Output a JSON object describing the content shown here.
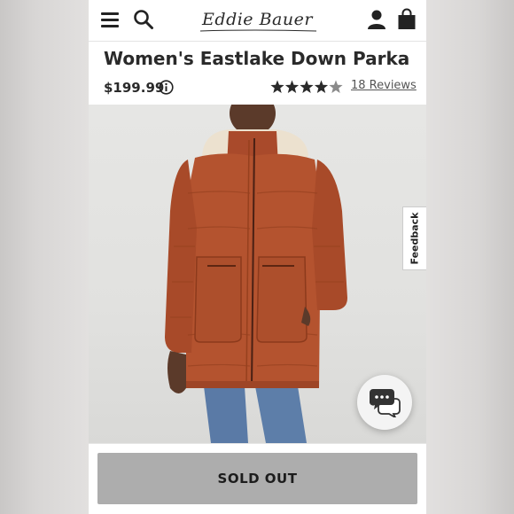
{
  "header": {
    "logo_text": "Eddie Bauer",
    "icons": [
      "menu-icon",
      "search-icon",
      "account-icon",
      "shopping-bag-icon"
    ]
  },
  "product": {
    "title": "Women's Eastlake Down Parka",
    "price": "$199.99",
    "rating": 4,
    "rating_max": 5,
    "reviews_label": "18 Reviews",
    "image_count": 2,
    "active_image": 1
  },
  "feedback": {
    "label": "Feedback"
  },
  "cta": {
    "label": "SOLD OUT"
  },
  "colors": {
    "parka": "#b4532f",
    "cta_bg": "#adadad",
    "star_filled": "#2a2a2a",
    "star_empty": "#8a8a8a"
  }
}
